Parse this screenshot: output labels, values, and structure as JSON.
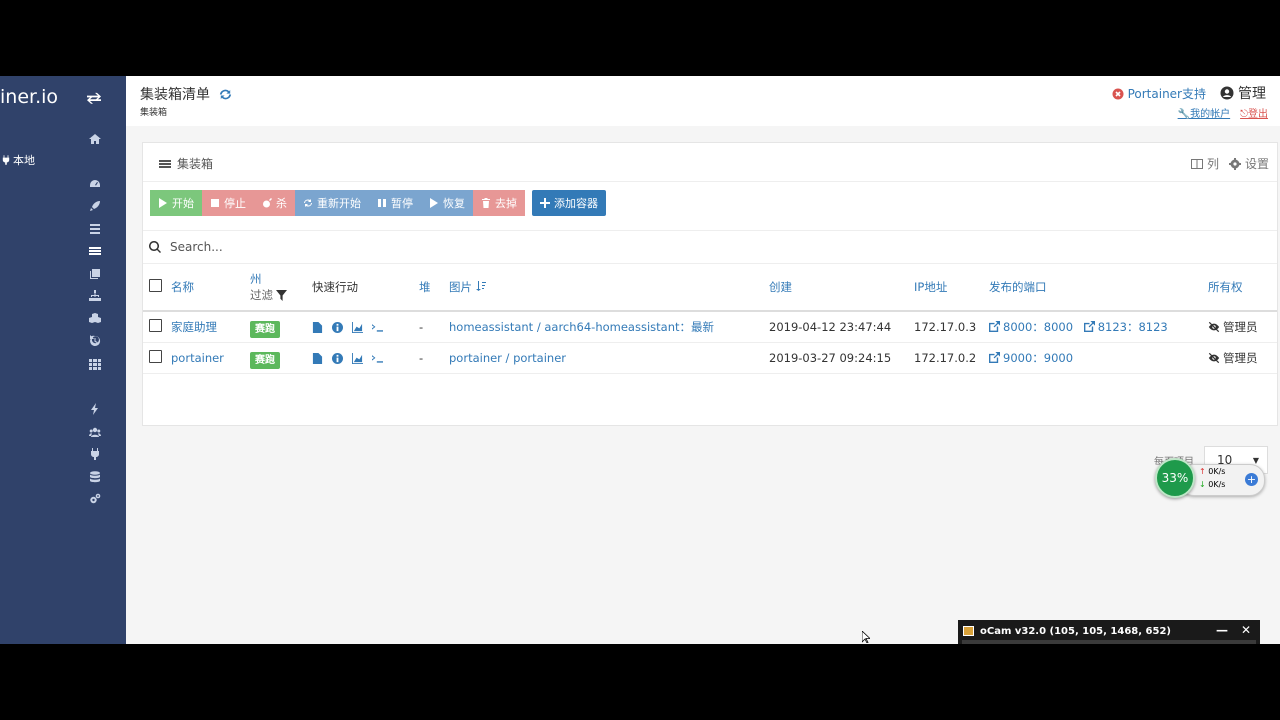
{
  "sidebar": {
    "brand": "iner.io",
    "endpoint": "本地"
  },
  "header": {
    "title": "集装箱清单",
    "subtitle": "集装箱",
    "support": "Portainer支持",
    "admin": "管理",
    "my_account": "我的帐户",
    "logout": "登出"
  },
  "widget": {
    "title": "集装箱",
    "columns_label": "列",
    "settings_label": "设置"
  },
  "toolbar": {
    "start": "开始",
    "stop": "停止",
    "kill": "杀",
    "restart": "重新开始",
    "pause": "暂停",
    "resume": "恢复",
    "remove": "去掉",
    "add": "添加容器"
  },
  "search": {
    "placeholder": "Search..."
  },
  "table": {
    "headers": {
      "name": "名称",
      "state": "州",
      "filter": "过滤",
      "quick_actions": "快速行动",
      "stack": "堆",
      "image": "图片",
      "created": "创建",
      "ip": "IP地址",
      "ports": "发布的端口",
      "ownership": "所有权"
    },
    "rows": [
      {
        "name": "家庭助理",
        "state": "赛跑",
        "stack": "-",
        "image": "homeassistant / aarch64-homeassistant：最新",
        "created": "2019-04-12 23:47:44",
        "ip": "172.17.0.3",
        "port1": "8000：8000",
        "port2": "8123：8123",
        "ownership": "管理员"
      },
      {
        "name": "portainer",
        "state": "赛跑",
        "stack": "-",
        "image": "portainer / portainer",
        "created": "2019-03-27 09:24:15",
        "ip": "172.17.0.2",
        "port1": "9000：9000",
        "ownership": "管理员"
      }
    ]
  },
  "pagination": {
    "label": "每页项目",
    "value": "10"
  },
  "speed_widget": {
    "percent": "33%",
    "up": "0K/s",
    "down": "0K/s"
  },
  "ocam": {
    "title": "oCam v32.0 (105, 105, 1468, 652)"
  },
  "colors": {
    "sidebar": "#30426a",
    "primary": "#337ab7",
    "running": "#5cb85c"
  }
}
